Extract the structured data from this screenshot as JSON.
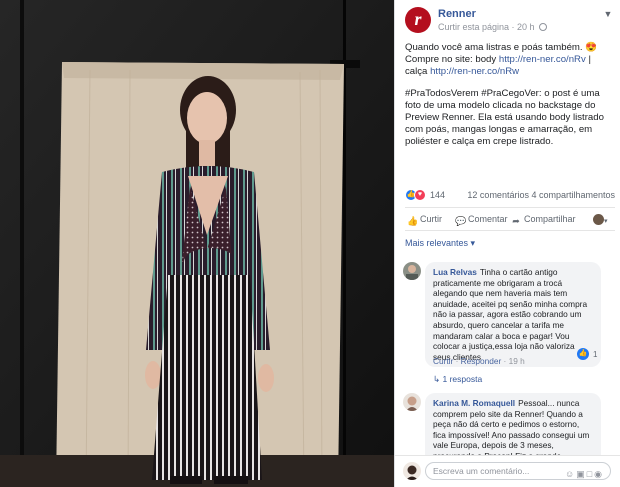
{
  "post": {
    "page_name": "Renner",
    "meta": "Curtir esta página · 20 h",
    "avatar_letter": "r",
    "text_line1": "Quando você ama listras e poás também. 😍",
    "text_line2_prefix": "Compre no site: body ",
    "link1": "http://ren-ner.co/nRv",
    "text_line2_mid": " | calça ",
    "link2": "http://ren-ner.co/nRw",
    "text_para2": "#PraTodosVerem #PraCegoVer: o post é uma foto de uma modelo clicada no backstage do Preview Renner. Ela está usando body listrado com poás, mangas longas e amarração, em poliéster e calça em crepe listrado."
  },
  "reactions": {
    "count": "144",
    "comments_shares": "12 comentários  4 compartilhamentos"
  },
  "actions": {
    "like": "Curtir",
    "comment": "Comentar",
    "share": "Compartilhar"
  },
  "sort_label": "Mais relevantes ▾",
  "comments": [
    {
      "author": "Lua Relvas",
      "text": "Tinha o cartão antigo praticamente me obrigaram a trocá alegando que nem haveria mais tem anuidade, aceitei pq senão minha compra não ia passar, agora estão cobrando um absurdo, quero cancelar a tarifa me mandaram calar a boca e pagar! Vou colocar a justiça,essa loja não valoriza seus clientes",
      "like_label": "Curtir",
      "reply_label": "Responder",
      "time": "19 h",
      "likes": "1",
      "replies": "1 resposta"
    },
    {
      "author": "Karina M. Romaquell",
      "text": "Pessoal... nunca comprem pelo site da Renner! Quando a peça não dá certo e pedimos o estorno, fica impossível! Ano passado consegui um vale Europa, depois de 3 meses, procurando o Procon! Fiz a grande besteira de comprar"
    }
  ],
  "composer": {
    "placeholder": "Escreva um comentário..."
  },
  "colors": {
    "brand_red": "#b40f1e",
    "link_blue": "#365899",
    "like_blue": "#2078f4"
  }
}
